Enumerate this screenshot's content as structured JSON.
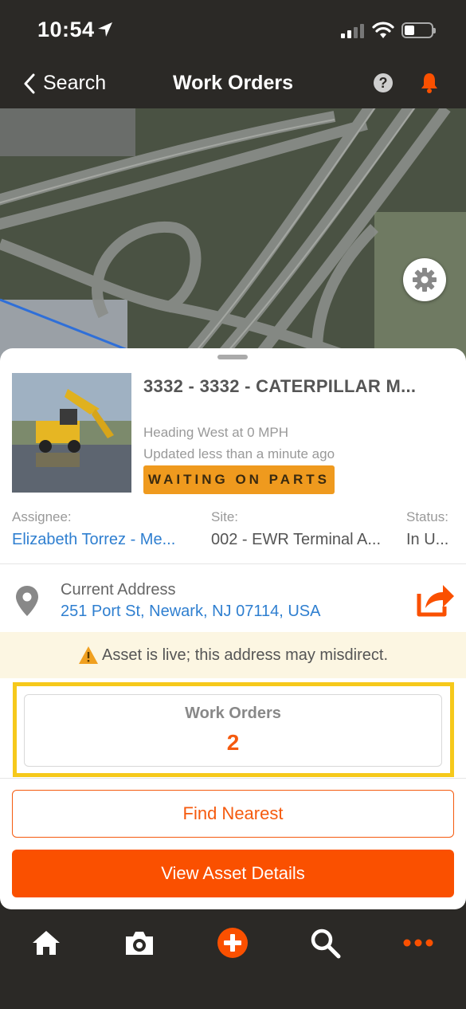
{
  "status_bar": {
    "time": "10:54"
  },
  "nav": {
    "back_label": "Search",
    "title": "Work Orders",
    "help_glyph": "?"
  },
  "asset": {
    "title": "3332 - 3332 - CATERPILLAR M...",
    "heading": "Heading West at 0 MPH",
    "updated": "Updated less than a minute ago",
    "status_badge": "WAITING ON PARTS",
    "assignee_label": "Assignee:",
    "assignee_value": "Elizabeth Torrez - Me...",
    "site_label": "Site:",
    "site_value": "002 - EWR Terminal A...",
    "status_label": "Status:",
    "status_value": "In U..."
  },
  "address": {
    "label": "Current Address",
    "value": "251 Port St, Newark, NJ 07114, USA"
  },
  "warning": {
    "text": "Asset is live; this address may misdirect."
  },
  "work_orders": {
    "label": "Work Orders",
    "count": "2"
  },
  "buttons": {
    "find_nearest": "Find Nearest",
    "view_details": "View Asset Details"
  },
  "colors": {
    "accent": "#fa5000",
    "link": "#2f7fd0",
    "badge": "#ef9a1e",
    "highlight": "#f6c91b",
    "chrome": "#2b2926"
  },
  "icons": [
    "location-arrow-icon",
    "wifi-icon",
    "battery-icon",
    "chevron-left-icon",
    "help-icon",
    "bell-icon",
    "gear-icon",
    "map-pin-icon",
    "share-icon",
    "warning-icon",
    "home-icon",
    "camera-icon",
    "add-icon",
    "search-icon",
    "more-icon"
  ]
}
